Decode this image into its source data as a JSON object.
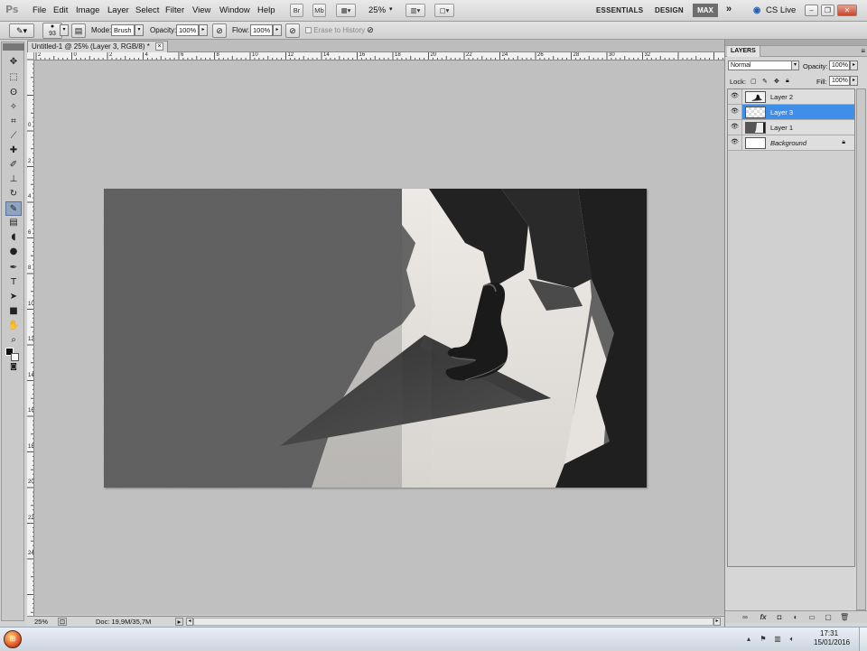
{
  "menubar": {
    "logo": "Ps",
    "items": [
      "File",
      "Edit",
      "Image",
      "Layer",
      "Select",
      "Filter",
      "View",
      "Window",
      "Help"
    ],
    "bridge_label": "Br",
    "minibridge_label": "Mb",
    "zoom": "25%",
    "workspaces": [
      "ESSENTIALS",
      "DESIGN",
      "MAX"
    ],
    "more": "»",
    "cs_live": "CS Live"
  },
  "options_bar": {
    "brush_size": "93",
    "mode_label": "Mode:",
    "mode_value": "Brush",
    "opacity_label": "Opacity:",
    "opacity_value": "100%",
    "flow_label": "Flow:",
    "flow_value": "100%",
    "erase_to_history": "Erase to History"
  },
  "document": {
    "tab_title": "Untitled-1 @ 25% (Layer 3, RGB/8) *",
    "ruler_labels": [
      "2",
      "0",
      "2",
      "4",
      "6",
      "8",
      "10",
      "12",
      "14",
      "16",
      "18",
      "20",
      "22",
      "24",
      "26",
      "28",
      "30",
      "32"
    ],
    "ruler_v_labels": [
      "0",
      "2",
      "4",
      "6",
      "8",
      "10",
      "12",
      "14",
      "16",
      "18",
      "20",
      "22",
      "24"
    ]
  },
  "status": {
    "zoom": "25%",
    "doc_info": "Doc: 19,9M/35,7M"
  },
  "layers_panel": {
    "tab": "LAYERS",
    "blend_mode": "Normal",
    "opacity_label": "Opacity:",
    "opacity_value": "100%",
    "lock_label": "Lock:",
    "fill_label": "Fill:",
    "fill_value": "100%",
    "layers": [
      {
        "name": "Layer 2",
        "selected": false
      },
      {
        "name": "Layer 3",
        "selected": true
      },
      {
        "name": "Layer 1",
        "selected": false
      },
      {
        "name": "Background",
        "selected": false
      }
    ]
  },
  "taskbar": {
    "time": "17:31",
    "date": "15/01/2016"
  },
  "colors": {
    "selected_layer": "#3f8ee8",
    "canvas_bg": "#c0c0c0",
    "max_workspace": "#6d6d6d"
  }
}
